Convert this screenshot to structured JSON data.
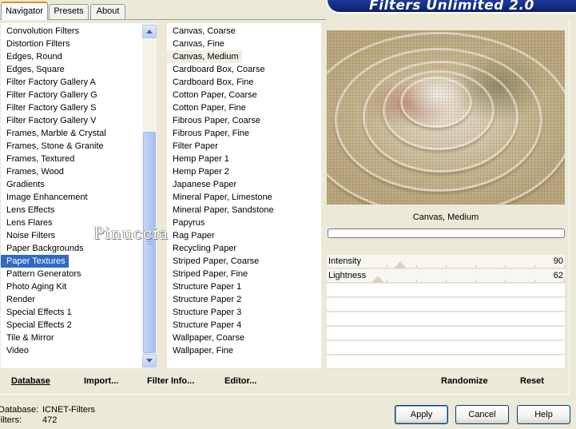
{
  "tabs": [
    {
      "label": "Navigator",
      "active": true
    },
    {
      "label": "Presets",
      "active": false
    },
    {
      "label": "About",
      "active": false
    }
  ],
  "app_title": "Filters Unlimited 2.0",
  "categories": [
    "Convolution Filters",
    "Distortion Filters",
    "Edges, Round",
    "Edges, Square",
    "Filter Factory Gallery A",
    "Filter Factory Gallery G",
    "Filter Factory Gallery S",
    "Filter Factory Gallery V",
    "Frames, Marble & Crystal",
    "Frames, Stone & Granite",
    "Frames, Textured",
    "Frames, Wood",
    "Gradients",
    "Image Enhancement",
    "Lens Effects",
    "Lens Flares",
    "Noise Filters",
    "Paper Backgrounds",
    "Paper Textures",
    "Pattern Generators",
    "Photo Aging Kit",
    "Render",
    "Special Effects 1",
    "Special Effects 2",
    "Tile & Mirror",
    "Video"
  ],
  "selected_category": "Paper Textures",
  "filters": [
    "Canvas, Coarse",
    "Canvas, Fine",
    "Canvas, Medium",
    "Cardboard Box, Coarse",
    "Cardboard Box, Fine",
    "Cotton Paper, Coarse",
    "Cotton Paper, Fine",
    "Fibrous Paper, Coarse",
    "Fibrous Paper, Fine",
    "Filter Paper",
    "Hemp Paper 1",
    "Hemp Paper 2",
    "Japanese Paper",
    "Mineral Paper, Limestone",
    "Mineral Paper, Sandstone",
    "Papyrus",
    "Rag Paper",
    "Recycling Paper",
    "Striped Paper, Coarse",
    "Striped Paper, Fine",
    "Structure Paper 1",
    "Structure Paper 2",
    "Structure Paper 3",
    "Structure Paper 4",
    "Wallpaper, Coarse",
    "Wallpaper, Fine"
  ],
  "selected_filter": "Canvas, Medium",
  "preview_caption": "Canvas, Medium",
  "params": [
    {
      "label": "Intensity",
      "value": 90
    },
    {
      "label": "Lightness",
      "value": 62
    }
  ],
  "toolbar": {
    "database_label": "Database",
    "import_label": "Import...",
    "filter_info_label": "Filter Info...",
    "editor_label": "Editor...",
    "randomize_label": "Randomize",
    "reset_label": "Reset"
  },
  "footer": {
    "database_key": "Database:",
    "database_value": "ICNET-Filters",
    "filters_key": "Filters:",
    "filters_value": "472"
  },
  "buttons": {
    "apply": "Apply",
    "cancel": "Cancel",
    "help": "Help"
  },
  "watermark": "Pinuccia",
  "colors": {
    "selection": "#316ac5",
    "dialog_bg": "#ece9d8",
    "banner": "#0a1f6e",
    "tab_accent": "#e68b2c"
  }
}
